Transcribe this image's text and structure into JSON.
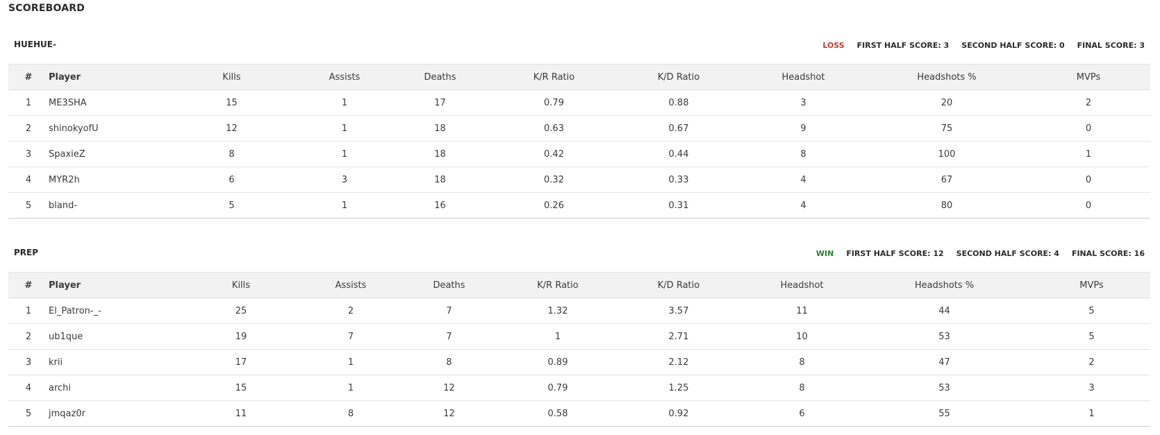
{
  "page_title": "SCOREBOARD",
  "colors": {
    "loss": "#c0392b",
    "win": "#2e7d32"
  },
  "columns": [
    "#",
    "Player",
    "Kills",
    "Assists",
    "Deaths",
    "K/R Ratio",
    "K/D Ratio",
    "Headshot",
    "Headshots %",
    "MVPs"
  ],
  "teams": [
    {
      "name": "HUEHUE-",
      "result": "LOSS",
      "first_half": "FIRST HALF SCORE: 3",
      "second_half": "SECOND HALF SCORE: 0",
      "final": "FINAL SCORE: 3",
      "rows": [
        [
          "1",
          "ME3SHA",
          "15",
          "1",
          "17",
          "0.79",
          "0.88",
          "3",
          "20",
          "2"
        ],
        [
          "2",
          "shinokyofU",
          "12",
          "1",
          "18",
          "0.63",
          "0.67",
          "9",
          "75",
          "0"
        ],
        [
          "3",
          "SpaxieZ",
          "8",
          "1",
          "18",
          "0.42",
          "0.44",
          "8",
          "100",
          "1"
        ],
        [
          "4",
          "MYR2h",
          "6",
          "3",
          "18",
          "0.32",
          "0.33",
          "4",
          "67",
          "0"
        ],
        [
          "5",
          "bland-",
          "5",
          "1",
          "16",
          "0.26",
          "0.31",
          "4",
          "80",
          "0"
        ]
      ]
    },
    {
      "name": "PREP",
      "result": "WIN",
      "first_half": "FIRST HALF SCORE: 12",
      "second_half": "SECOND HALF SCORE: 4",
      "final": "FINAL SCORE: 16",
      "rows": [
        [
          "1",
          "El_Patron-_-",
          "25",
          "2",
          "7",
          "1.32",
          "3.57",
          "11",
          "44",
          "5"
        ],
        [
          "2",
          "ub1que",
          "19",
          "7",
          "7",
          "1",
          "2.71",
          "10",
          "53",
          "5"
        ],
        [
          "3",
          "krii",
          "17",
          "1",
          "8",
          "0.89",
          "2.12",
          "8",
          "47",
          "2"
        ],
        [
          "4",
          "archi",
          "15",
          "1",
          "12",
          "0.79",
          "1.25",
          "8",
          "53",
          "3"
        ],
        [
          "5",
          "jmqaz0r",
          "11",
          "8",
          "12",
          "0.58",
          "0.92",
          "6",
          "55",
          "1"
        ]
      ]
    }
  ]
}
